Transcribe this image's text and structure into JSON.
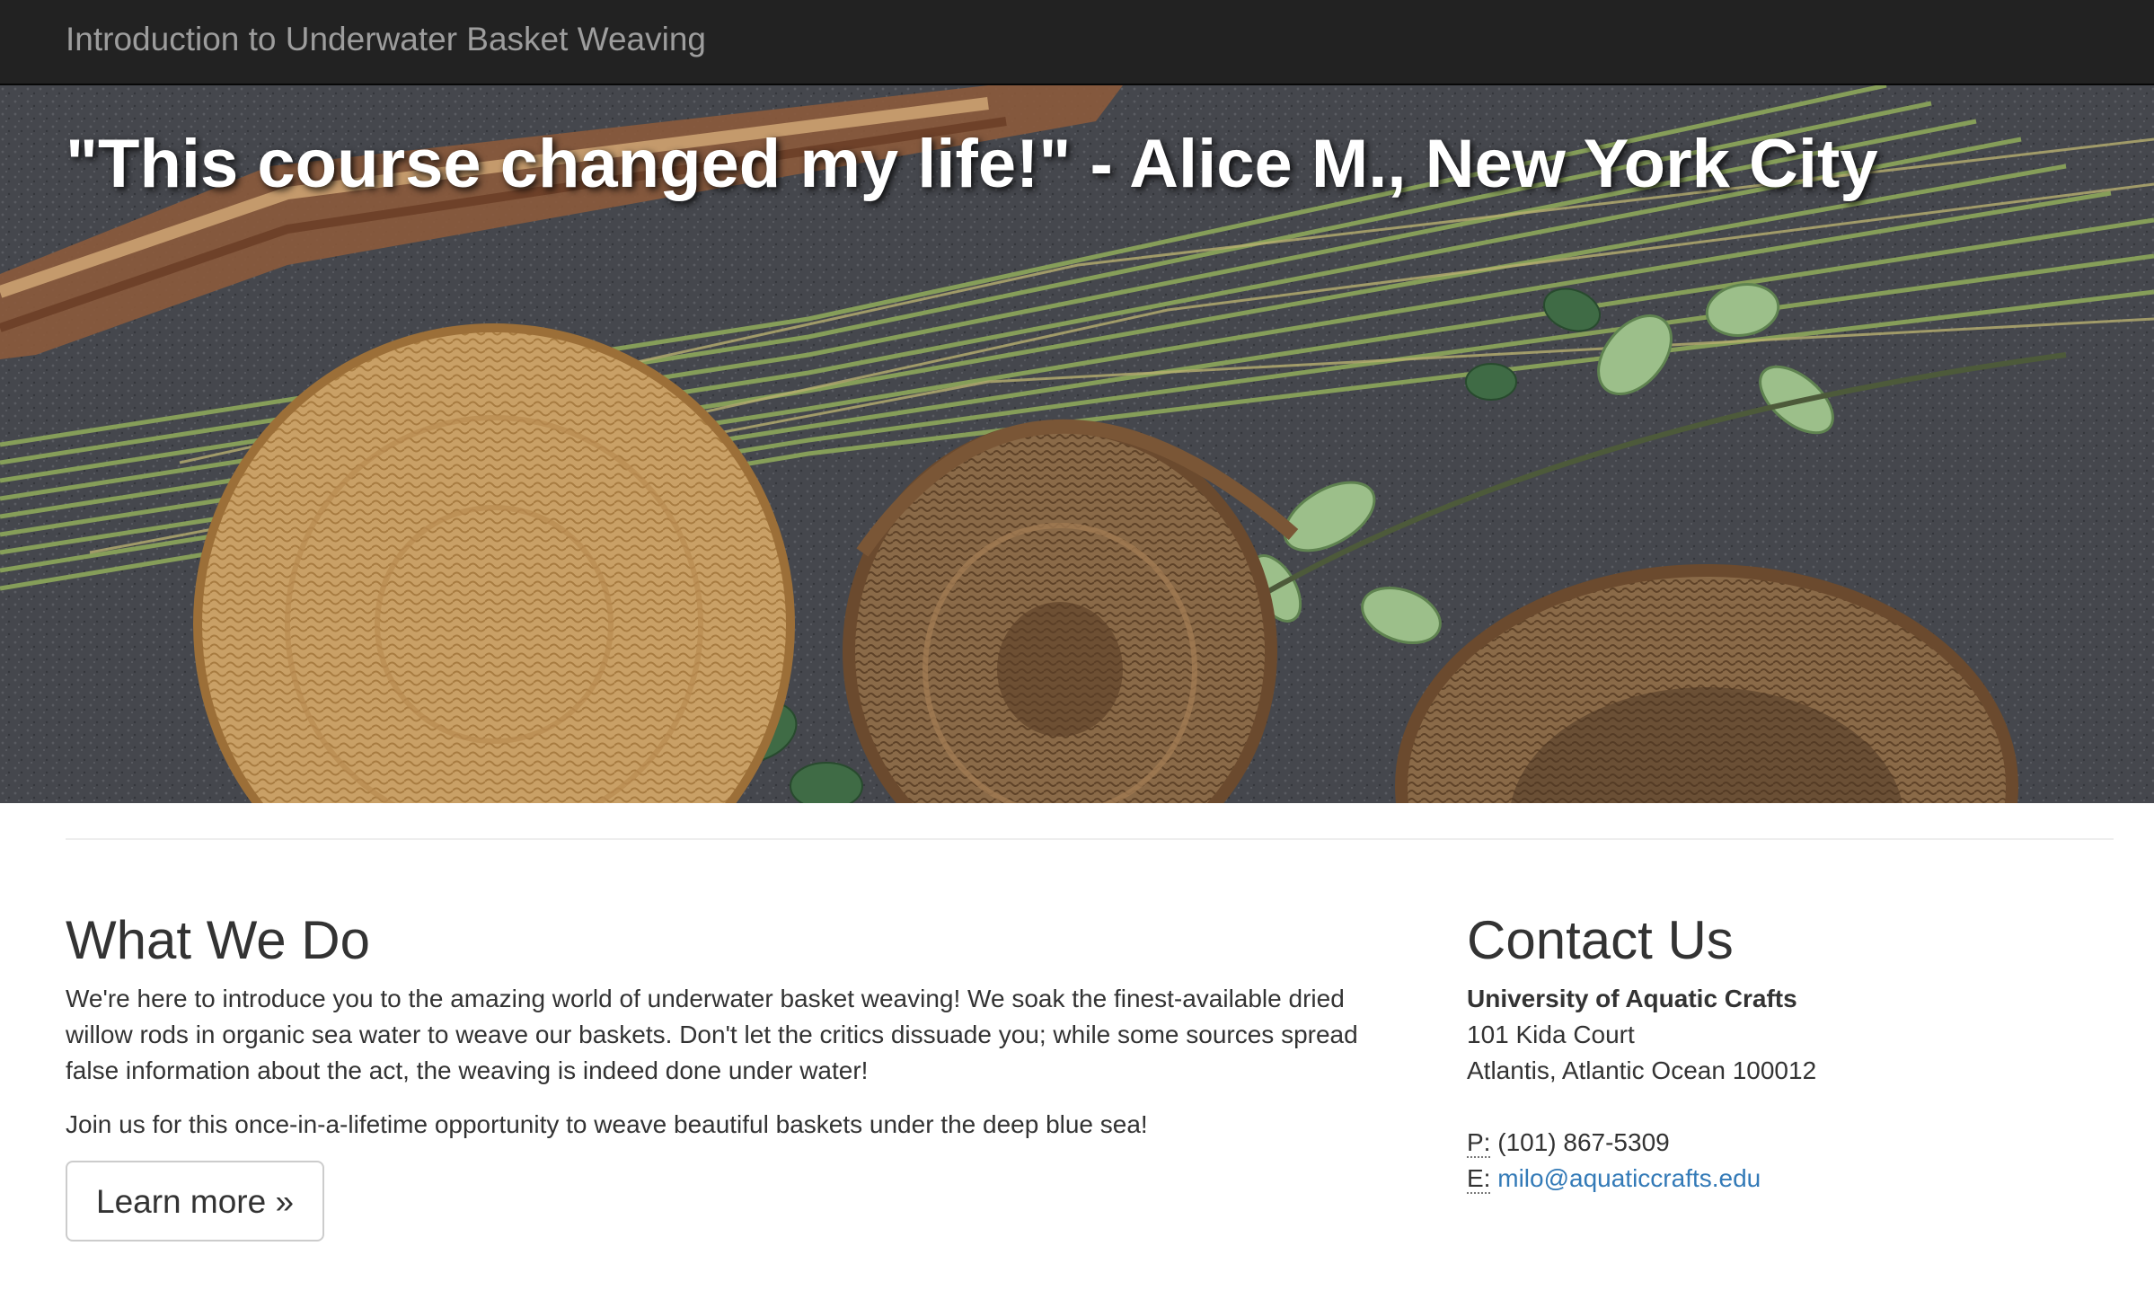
{
  "navbar": {
    "brand": "Introduction to Underwater Basket Weaving"
  },
  "hero": {
    "quote": "\"This course changed my life!\" - Alice M., New York City"
  },
  "what_we_do": {
    "heading": "What We Do",
    "paragraph1": "We're here to introduce you to the amazing world of underwater basket weaving! We soak the finest-available dried willow rods in organic sea water to weave our baskets. Don't let the critics dissuade you; while some sources spread false information about the act, the weaving is indeed done under water!",
    "paragraph2": "Join us for this once-in-a-lifetime opportunity to weave beautiful baskets under the deep blue sea!",
    "button_label": "Learn more »"
  },
  "contact": {
    "heading": "Contact Us",
    "org": "University of Aquatic Crafts",
    "street": "101 Kida Court",
    "city": "Atlantis, Atlantic Ocean 100012",
    "phone_abbr": "P:",
    "phone": "(101) 867-5309",
    "email_abbr": "E:",
    "email": "milo@aquaticcrafts.edu"
  },
  "colors": {
    "navbar_bg": "#222222",
    "brand_text": "#9d9d9d",
    "link": "#337ab7",
    "asphalt": "#3f4146"
  }
}
